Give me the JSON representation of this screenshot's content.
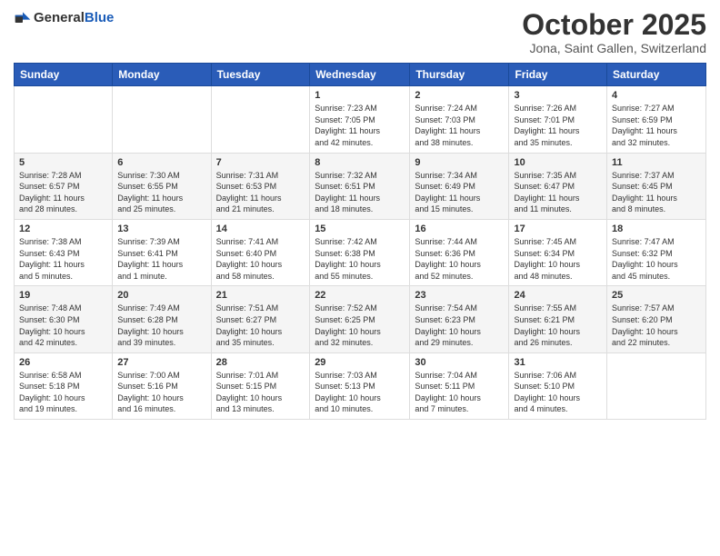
{
  "header": {
    "logo_general": "General",
    "logo_blue": "Blue",
    "month_title": "October 2025",
    "subtitle": "Jona, Saint Gallen, Switzerland"
  },
  "days_of_week": [
    "Sunday",
    "Monday",
    "Tuesday",
    "Wednesday",
    "Thursday",
    "Friday",
    "Saturday"
  ],
  "weeks": [
    [
      {
        "day": "",
        "info": ""
      },
      {
        "day": "",
        "info": ""
      },
      {
        "day": "",
        "info": ""
      },
      {
        "day": "1",
        "info": "Sunrise: 7:23 AM\nSunset: 7:05 PM\nDaylight: 11 hours\nand 42 minutes."
      },
      {
        "day": "2",
        "info": "Sunrise: 7:24 AM\nSunset: 7:03 PM\nDaylight: 11 hours\nand 38 minutes."
      },
      {
        "day": "3",
        "info": "Sunrise: 7:26 AM\nSunset: 7:01 PM\nDaylight: 11 hours\nand 35 minutes."
      },
      {
        "day": "4",
        "info": "Sunrise: 7:27 AM\nSunset: 6:59 PM\nDaylight: 11 hours\nand 32 minutes."
      }
    ],
    [
      {
        "day": "5",
        "info": "Sunrise: 7:28 AM\nSunset: 6:57 PM\nDaylight: 11 hours\nand 28 minutes."
      },
      {
        "day": "6",
        "info": "Sunrise: 7:30 AM\nSunset: 6:55 PM\nDaylight: 11 hours\nand 25 minutes."
      },
      {
        "day": "7",
        "info": "Sunrise: 7:31 AM\nSunset: 6:53 PM\nDaylight: 11 hours\nand 21 minutes."
      },
      {
        "day": "8",
        "info": "Sunrise: 7:32 AM\nSunset: 6:51 PM\nDaylight: 11 hours\nand 18 minutes."
      },
      {
        "day": "9",
        "info": "Sunrise: 7:34 AM\nSunset: 6:49 PM\nDaylight: 11 hours\nand 15 minutes."
      },
      {
        "day": "10",
        "info": "Sunrise: 7:35 AM\nSunset: 6:47 PM\nDaylight: 11 hours\nand 11 minutes."
      },
      {
        "day": "11",
        "info": "Sunrise: 7:37 AM\nSunset: 6:45 PM\nDaylight: 11 hours\nand 8 minutes."
      }
    ],
    [
      {
        "day": "12",
        "info": "Sunrise: 7:38 AM\nSunset: 6:43 PM\nDaylight: 11 hours\nand 5 minutes."
      },
      {
        "day": "13",
        "info": "Sunrise: 7:39 AM\nSunset: 6:41 PM\nDaylight: 11 hours\nand 1 minute."
      },
      {
        "day": "14",
        "info": "Sunrise: 7:41 AM\nSunset: 6:40 PM\nDaylight: 10 hours\nand 58 minutes."
      },
      {
        "day": "15",
        "info": "Sunrise: 7:42 AM\nSunset: 6:38 PM\nDaylight: 10 hours\nand 55 minutes."
      },
      {
        "day": "16",
        "info": "Sunrise: 7:44 AM\nSunset: 6:36 PM\nDaylight: 10 hours\nand 52 minutes."
      },
      {
        "day": "17",
        "info": "Sunrise: 7:45 AM\nSunset: 6:34 PM\nDaylight: 10 hours\nand 48 minutes."
      },
      {
        "day": "18",
        "info": "Sunrise: 7:47 AM\nSunset: 6:32 PM\nDaylight: 10 hours\nand 45 minutes."
      }
    ],
    [
      {
        "day": "19",
        "info": "Sunrise: 7:48 AM\nSunset: 6:30 PM\nDaylight: 10 hours\nand 42 minutes."
      },
      {
        "day": "20",
        "info": "Sunrise: 7:49 AM\nSunset: 6:28 PM\nDaylight: 10 hours\nand 39 minutes."
      },
      {
        "day": "21",
        "info": "Sunrise: 7:51 AM\nSunset: 6:27 PM\nDaylight: 10 hours\nand 35 minutes."
      },
      {
        "day": "22",
        "info": "Sunrise: 7:52 AM\nSunset: 6:25 PM\nDaylight: 10 hours\nand 32 minutes."
      },
      {
        "day": "23",
        "info": "Sunrise: 7:54 AM\nSunset: 6:23 PM\nDaylight: 10 hours\nand 29 minutes."
      },
      {
        "day": "24",
        "info": "Sunrise: 7:55 AM\nSunset: 6:21 PM\nDaylight: 10 hours\nand 26 minutes."
      },
      {
        "day": "25",
        "info": "Sunrise: 7:57 AM\nSunset: 6:20 PM\nDaylight: 10 hours\nand 22 minutes."
      }
    ],
    [
      {
        "day": "26",
        "info": "Sunrise: 6:58 AM\nSunset: 5:18 PM\nDaylight: 10 hours\nand 19 minutes."
      },
      {
        "day": "27",
        "info": "Sunrise: 7:00 AM\nSunset: 5:16 PM\nDaylight: 10 hours\nand 16 minutes."
      },
      {
        "day": "28",
        "info": "Sunrise: 7:01 AM\nSunset: 5:15 PM\nDaylight: 10 hours\nand 13 minutes."
      },
      {
        "day": "29",
        "info": "Sunrise: 7:03 AM\nSunset: 5:13 PM\nDaylight: 10 hours\nand 10 minutes."
      },
      {
        "day": "30",
        "info": "Sunrise: 7:04 AM\nSunset: 5:11 PM\nDaylight: 10 hours\nand 7 minutes."
      },
      {
        "day": "31",
        "info": "Sunrise: 7:06 AM\nSunset: 5:10 PM\nDaylight: 10 hours\nand 4 minutes."
      },
      {
        "day": "",
        "info": ""
      }
    ]
  ]
}
